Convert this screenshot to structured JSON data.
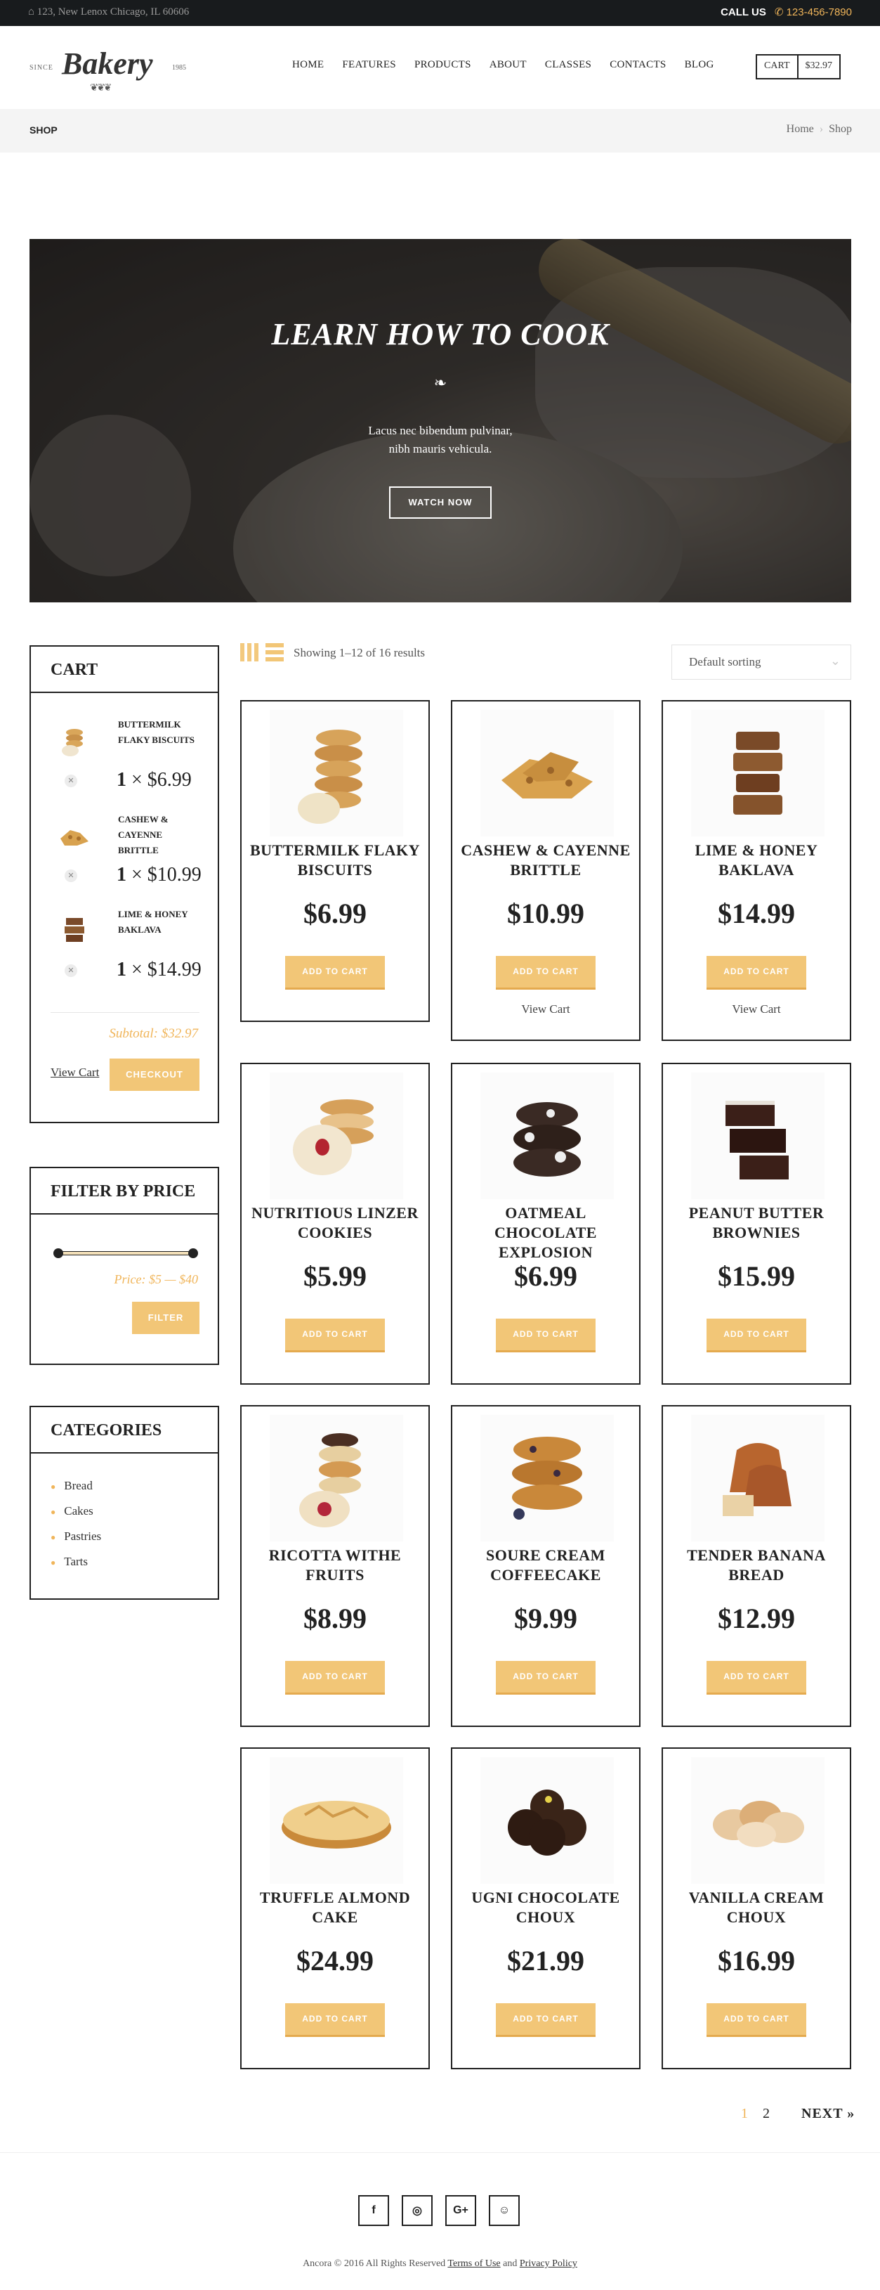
{
  "topbar": {
    "address": "123, New Lenox Chicago, IL 60606",
    "call_label": "CALL US",
    "phone": "123-456-7890"
  },
  "logo": {
    "since": "SINCE",
    "word": "Bakery",
    "year": "1985"
  },
  "nav": [
    "HOME",
    "FEATURES",
    "PRODUCTS",
    "ABOUT",
    "CLASSES",
    "CONTACTS",
    "BLOG"
  ],
  "header_cart": {
    "label": "CART",
    "amount": "$32.97"
  },
  "page": {
    "title": "SHOP",
    "breadcrumb": [
      "Home",
      "Shop"
    ]
  },
  "hero": {
    "title": "LEARN HOW TO COOK",
    "text": "Lacus nec bibendum pulvinar, nibh mauris vehicula.",
    "button": "WATCH NOW"
  },
  "cart_widget": {
    "title": "CART",
    "items": [
      {
        "name": "BUTTERMILK FLAKY BISCUITS",
        "qty": "1",
        "price": "$6.99"
      },
      {
        "name": "CASHEW & CAYENNE BRITTLE",
        "qty": "1",
        "price": "$10.99"
      },
      {
        "name": "LIME & HONEY BAKLAVA",
        "qty": "1",
        "price": "$14.99"
      }
    ],
    "subtotal": "Subtotal: $32.97",
    "view_cart": "View Cart",
    "checkout": "CHECKOUT"
  },
  "price_filter": {
    "title": "FILTER BY PRICE",
    "range": "Price: $5 — $40",
    "button": "FILTER",
    "min": 5,
    "max": 40
  },
  "categories": {
    "title": "CATEGORIES",
    "items": [
      "Bread",
      "Cakes",
      "Pastries",
      "Tarts"
    ]
  },
  "toolbar": {
    "results": "Showing 1–12 of 16 results",
    "sort": "Default sorting"
  },
  "products": [
    {
      "name": "BUTTERMILK FLAKY BISCUITS",
      "price": "$6.99",
      "button": "ADD TO CART",
      "view_cart": ""
    },
    {
      "name": "CASHEW & CAYENNE BRITTLE",
      "price": "$10.99",
      "button": "ADD TO CART",
      "view_cart": "View Cart"
    },
    {
      "name": "LIME & HONEY BAKLAVA",
      "price": "$14.99",
      "button": "ADD TO CART",
      "view_cart": "View Cart"
    },
    {
      "name": "NUTRITIOUS LINZER COOKIES",
      "price": "$5.99",
      "button": "ADD TO CART",
      "view_cart": ""
    },
    {
      "name": "OATMEAL CHOCOLATE EXPLOSION",
      "price": "$6.99",
      "button": "ADD TO CART",
      "view_cart": ""
    },
    {
      "name": "PEANUT BUTTER BROWNIES",
      "price": "$15.99",
      "button": "ADD TO CART",
      "view_cart": ""
    },
    {
      "name": "RICOTTA WITHE FRUITS",
      "price": "$8.99",
      "button": "ADD TO CART",
      "view_cart": ""
    },
    {
      "name": "SOURE CREAM COFFEECAKE",
      "price": "$9.99",
      "button": "ADD TO CART",
      "view_cart": ""
    },
    {
      "name": "TENDER BANANA BREAD",
      "price": "$12.99",
      "button": "ADD TO CART",
      "view_cart": ""
    },
    {
      "name": "TRUFFLE ALMOND CAKE",
      "price": "$24.99",
      "button": "ADD TO CART",
      "view_cart": ""
    },
    {
      "name": "UGNI CHOCOLATE CHOUX",
      "price": "$21.99",
      "button": "ADD TO CART",
      "view_cart": ""
    },
    {
      "name": "VANILLA CREAM CHOUX",
      "price": "$16.99",
      "button": "ADD TO CART",
      "view_cart": ""
    }
  ],
  "pagination": {
    "pages": [
      "1",
      "2"
    ],
    "next": "NEXT »"
  },
  "footer": {
    "social": [
      "f",
      "◎",
      "G+",
      "☺"
    ],
    "copyright": "Ancora © 2016 All Rights Reserved",
    "terms": "Terms of Use",
    "and": "and",
    "privacy": "Privacy Policy"
  },
  "colors": {
    "accent": "#f2c677",
    "dark": "#181b1d"
  }
}
